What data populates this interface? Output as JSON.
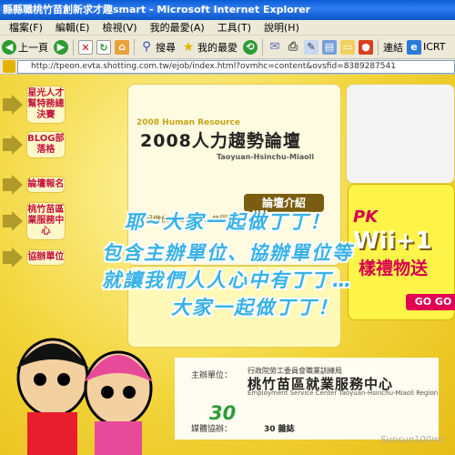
{
  "window": {
    "title": "縣縣職桃竹苗創新求才趣smart - Microsoft Internet Explorer"
  },
  "menu": [
    "檔案(F)",
    "編輯(E)",
    "檢視(V)",
    "我的最愛(A)",
    "工具(T)",
    "說明(H)"
  ],
  "toolbar": {
    "back": "上一頁",
    "search": "搜尋",
    "favorites": "我的最愛",
    "links": "連結",
    "icrt": "ICRT"
  },
  "address": {
    "url": "http://tpeon.evta.shotting.com.tw/ejob/index.html?ovmhc=content&ovsfid=8389287541"
  },
  "sidebar": {
    "items": [
      {
        "label": "星光人才幫特務總決賽"
      },
      {
        "label": "BLOG部落格"
      },
      {
        "label": "論壇報名"
      },
      {
        "label": "桃竹苗區業服務中心"
      },
      {
        "label": "協辦單位"
      }
    ]
  },
  "forum": {
    "en_label": "2008 Human Resource",
    "title": "2008人力趨勢論壇",
    "subtitle": "Taoyuan-Hsinchu-Miaoli",
    "intro_button": "論壇介紹",
    "intro_text": "一起做伙… 2007… 共同與會…"
  },
  "promo": {
    "pk": "PK",
    "wii": "Wii+1",
    "gift": "樣禮物送",
    "go": "GO GO"
  },
  "overlay_lines": [
    "耶~大家一起做丁丁！",
    "包含主辦單位、協辦單位等",
    "就讓我們人人心中有丁丁…",
    "大家一起做丁丁！"
  ],
  "footer": {
    "organizer_label": "主辦單位：",
    "organizer_small": "行政院勞工委員會職業訓練局",
    "organizer": "桃竹苗區就業服務中心",
    "organizer_en": "Employment Service Center Taoyuan-Hsinchu-Miaoli Region",
    "media_label": "媒體協辦：",
    "media_logo_text": "30",
    "media_logo2": "30 雜誌"
  },
  "watermark": "Sunsun100mc"
}
